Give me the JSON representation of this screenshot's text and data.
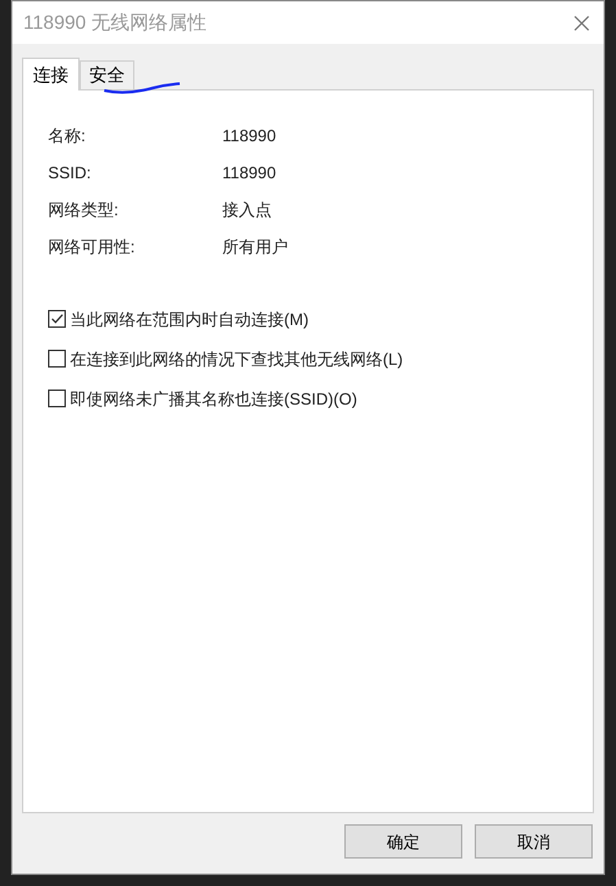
{
  "window": {
    "title": "118990 无线网络属性"
  },
  "tabs": [
    {
      "label": "连接",
      "selected": true
    },
    {
      "label": "安全",
      "selected": false
    }
  ],
  "properties": [
    {
      "label": "名称:",
      "value": "118990"
    },
    {
      "label": "SSID:",
      "value": "118990"
    },
    {
      "label": "网络类型:",
      "value": "接入点"
    },
    {
      "label": "网络可用性:",
      "value": "所有用户"
    }
  ],
  "options": [
    {
      "label": "当此网络在范围内时自动连接(M)",
      "checked": true
    },
    {
      "label": "在连接到此网络的情况下查找其他无线网络(L)",
      "checked": false
    },
    {
      "label": "即使网络未广播其名称也连接(SSID)(O)",
      "checked": false
    }
  ],
  "buttons": [
    "确定",
    "取消"
  ]
}
